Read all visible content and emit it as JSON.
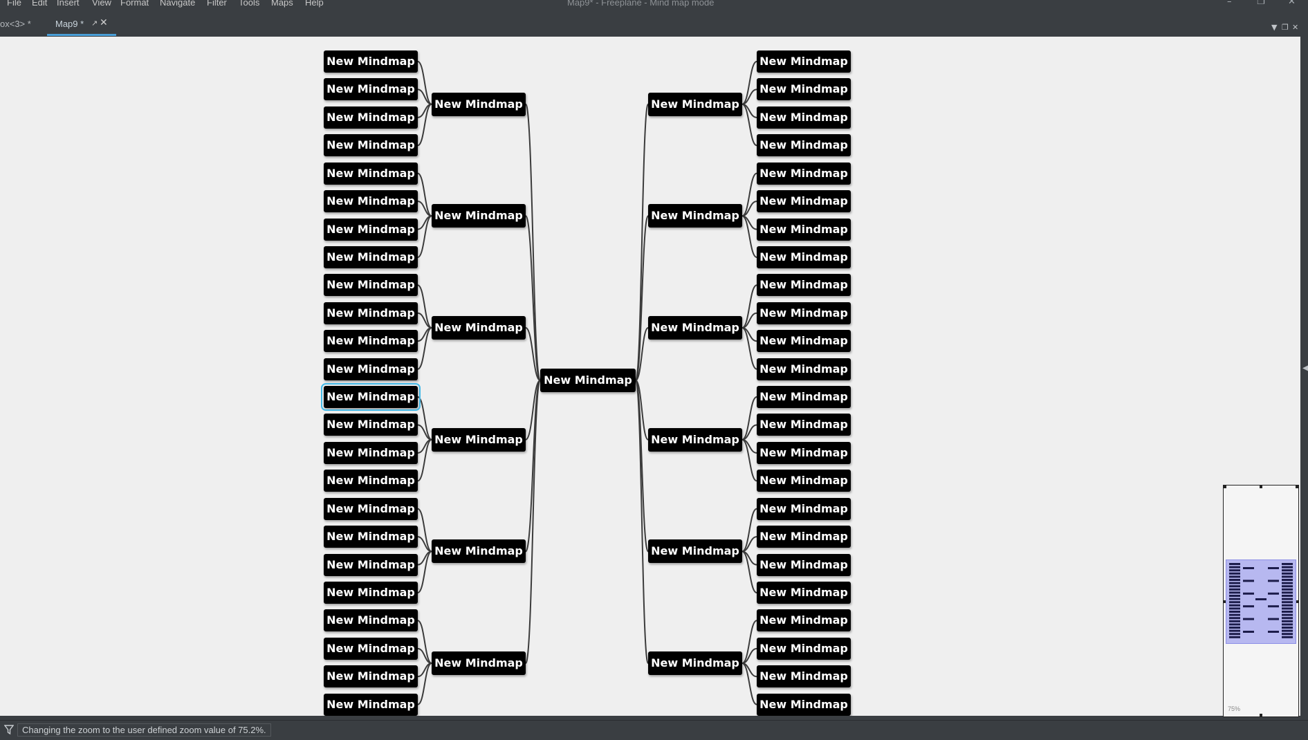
{
  "window": {
    "title": "Map9* - Freeplane - Mind map mode",
    "controls": [
      "–",
      "❐",
      "✕"
    ]
  },
  "menubar": {
    "items": [
      "File",
      "Edit",
      "Insert",
      "View",
      "Format",
      "Navigate",
      "Filter",
      "Tools",
      "Maps",
      "Help"
    ]
  },
  "tabs": [
    {
      "label": "ox<3> *",
      "active": false
    },
    {
      "label": "Map9 *",
      "active": true
    }
  ],
  "mindmap": {
    "root_label": "New Mindmap",
    "branch_label": "New Mindmap",
    "leaf_label": "New Mindmap",
    "branches_per_side": 6,
    "leaves_per_branch": 4,
    "selected_leaf": {
      "side": "left",
      "branch": 3,
      "leaf": 0
    }
  },
  "minimap": {
    "zoom_label": "75%"
  },
  "statusbar": {
    "message": "Changing the zoom to the user defined zoom value of 75.2%."
  },
  "colors": {
    "accent": "#42b8e6",
    "node_bg": "#000000",
    "node_text": "#ffffff",
    "canvas_bg": "#efefef",
    "chrome_bg": "#3a3e42",
    "minimap_view": "#b7b8f0"
  }
}
